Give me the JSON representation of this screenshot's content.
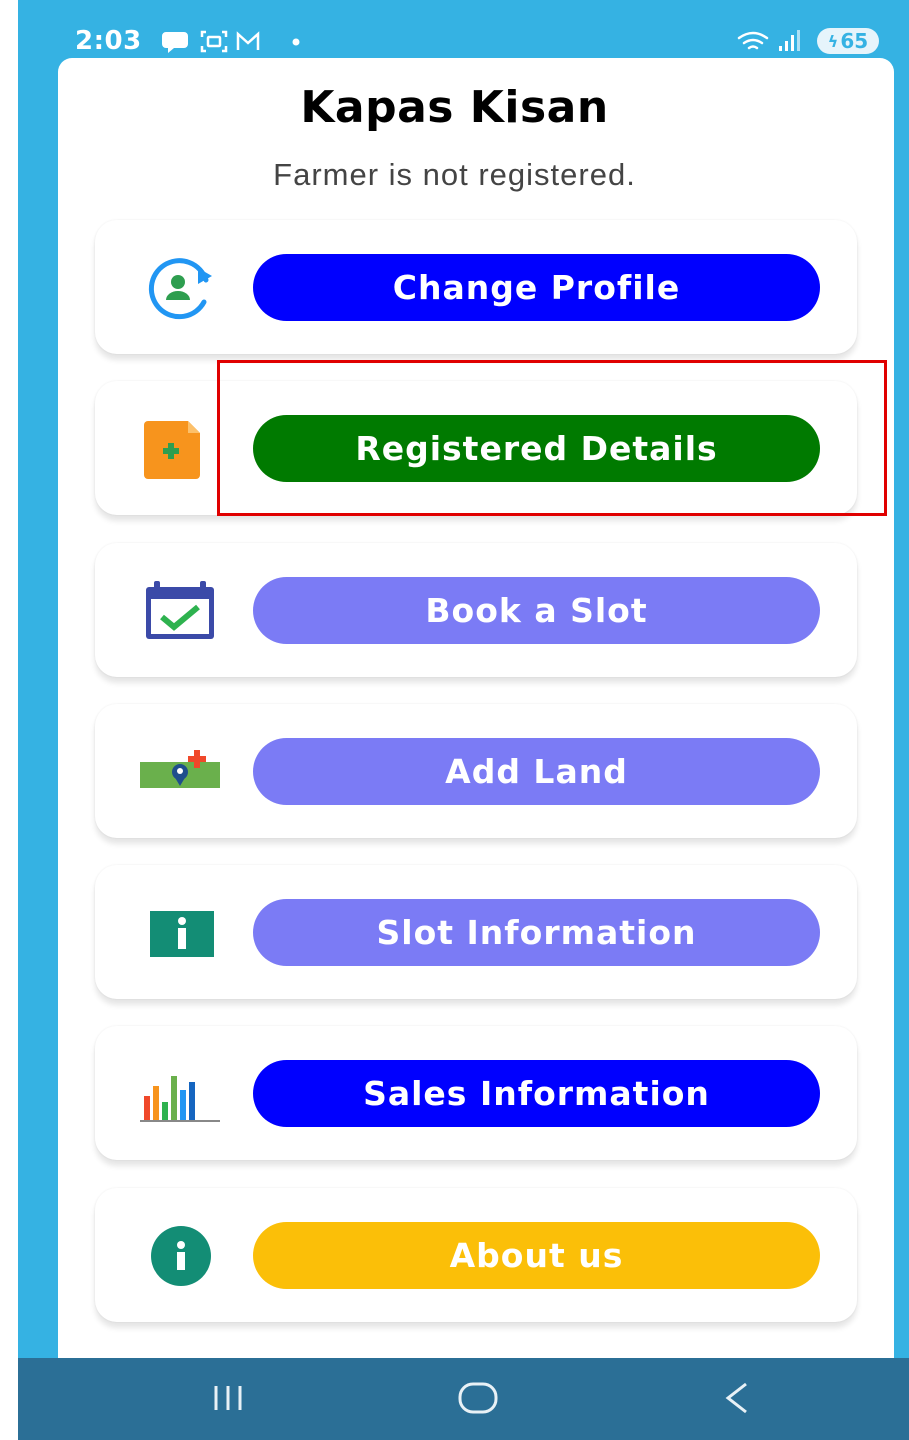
{
  "status_bar": {
    "time": "2:03",
    "battery": "65"
  },
  "header": {
    "title": "Kapas Kisan",
    "subtitle": "Farmer is not registered."
  },
  "menu": [
    {
      "id": "change-profile",
      "label": "Change Profile",
      "color": "#0000ff",
      "icon": "profile-refresh-icon"
    },
    {
      "id": "registered-details",
      "label": "Registered Details",
      "color": "#007a00",
      "icon": "document-add-icon"
    },
    {
      "id": "book-slot",
      "label": "Book a Slot",
      "color": "#7b7bf5",
      "icon": "calendar-check-icon"
    },
    {
      "id": "add-land",
      "label": "Add Land",
      "color": "#7b7bf5",
      "icon": "map-pin-add-icon"
    },
    {
      "id": "slot-information",
      "label": "Slot Information",
      "color": "#7b7bf5",
      "icon": "info-square-icon"
    },
    {
      "id": "sales-information",
      "label": "Sales Information",
      "color": "#0000ff",
      "icon": "bar-chart-icon"
    },
    {
      "id": "about-us",
      "label": "About us",
      "color": "#fbbf08",
      "icon": "info-circle-icon"
    }
  ],
  "highlight": {
    "target": "registered-details",
    "color": "#e00000"
  },
  "colors": {
    "background": "#35b2e3",
    "nav_bar": "#2b6f96"
  }
}
